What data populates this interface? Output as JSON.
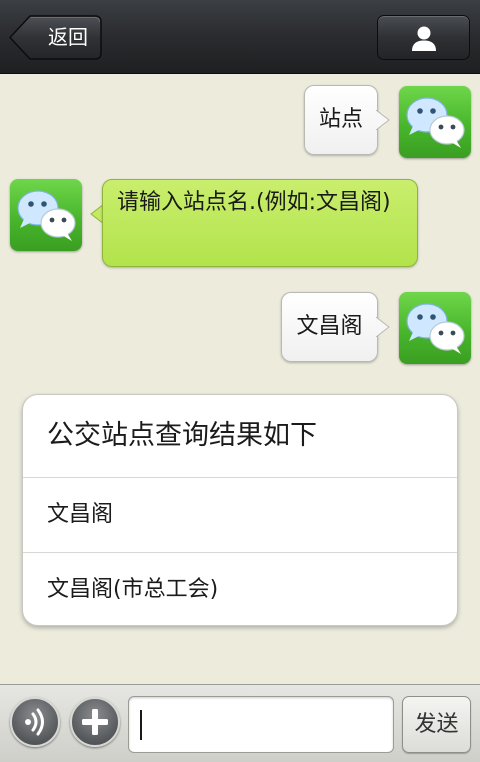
{
  "header": {
    "back_label": "返回",
    "profile_icon": "person-icon"
  },
  "messages": [
    {
      "side": "sent",
      "text": "站点"
    },
    {
      "side": "received",
      "text": "请输入站点名.(例如:文昌阁)"
    },
    {
      "side": "sent",
      "text": "文昌阁"
    }
  ],
  "result_card": {
    "title": "公交站点查询结果如下",
    "items": [
      "文昌阁",
      "文昌阁(市总工会)"
    ]
  },
  "input_bar": {
    "voice_icon": "voice-icon",
    "add_icon": "plus-icon",
    "message_value": "",
    "send_label": "发送"
  },
  "colors": {
    "header_bg": "#2b2d30",
    "chat_bg": "#ecebdc",
    "received_bubble": "#b9e655",
    "sent_bubble": "#ffffff",
    "avatar_green": "#4cba2e"
  }
}
